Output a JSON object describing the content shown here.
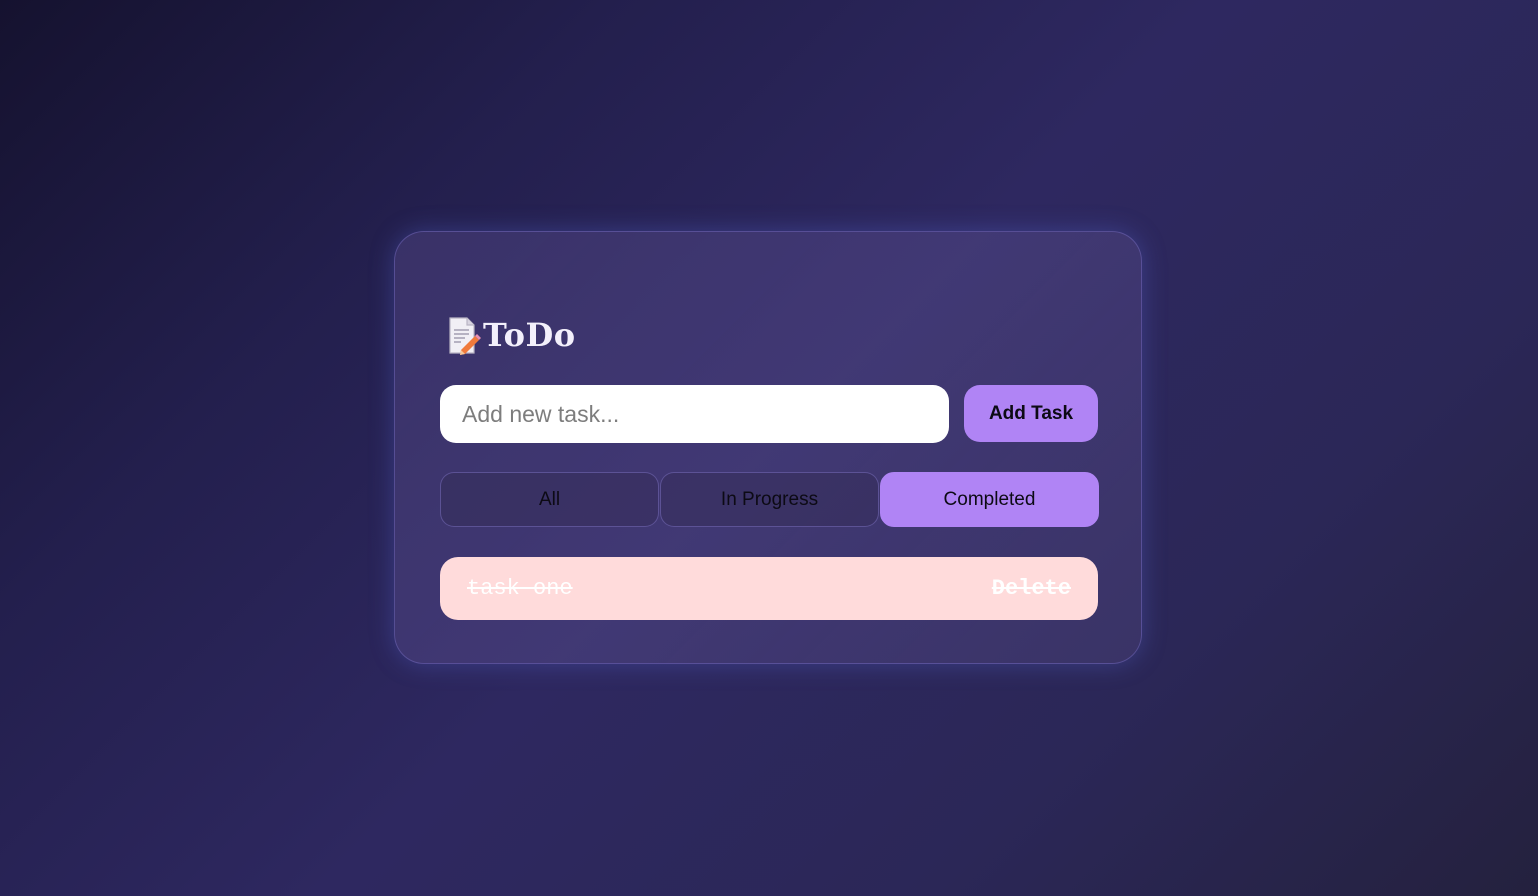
{
  "app": {
    "title": "ToDo",
    "title_icon": "memo-icon"
  },
  "input": {
    "placeholder": "Add new task...",
    "value": ""
  },
  "add_button": {
    "label": "Add Task"
  },
  "filters": [
    {
      "label": "All",
      "active": false
    },
    {
      "label": "In Progress",
      "active": false
    },
    {
      "label": "Completed",
      "active": true
    }
  ],
  "tasks": [
    {
      "text": "task one",
      "completed": true,
      "delete_label": "Delete"
    }
  ],
  "colors": {
    "accent": "#b084f5",
    "completed_task_bg": "#ffdbdb",
    "card_border": "#786ec8"
  }
}
